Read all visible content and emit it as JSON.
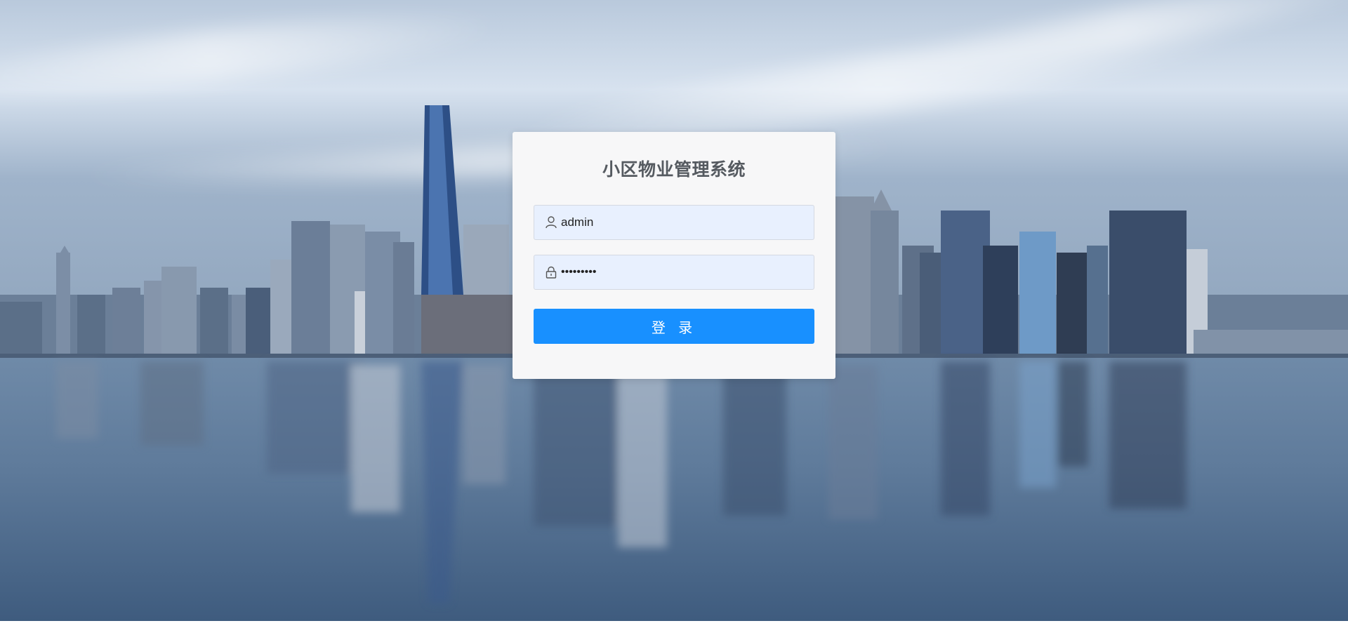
{
  "app": {
    "title": "小区物业管理系统"
  },
  "login": {
    "username_value": "admin",
    "password_value": "•••••••••",
    "submit_label": "登 录",
    "icons": {
      "username": "user-icon",
      "password": "lock-icon"
    }
  },
  "colors": {
    "primary_button": "#1890ff",
    "input_background": "#e8f0fe",
    "card_background": "#f7f7f8",
    "title_text": "#555a60"
  }
}
